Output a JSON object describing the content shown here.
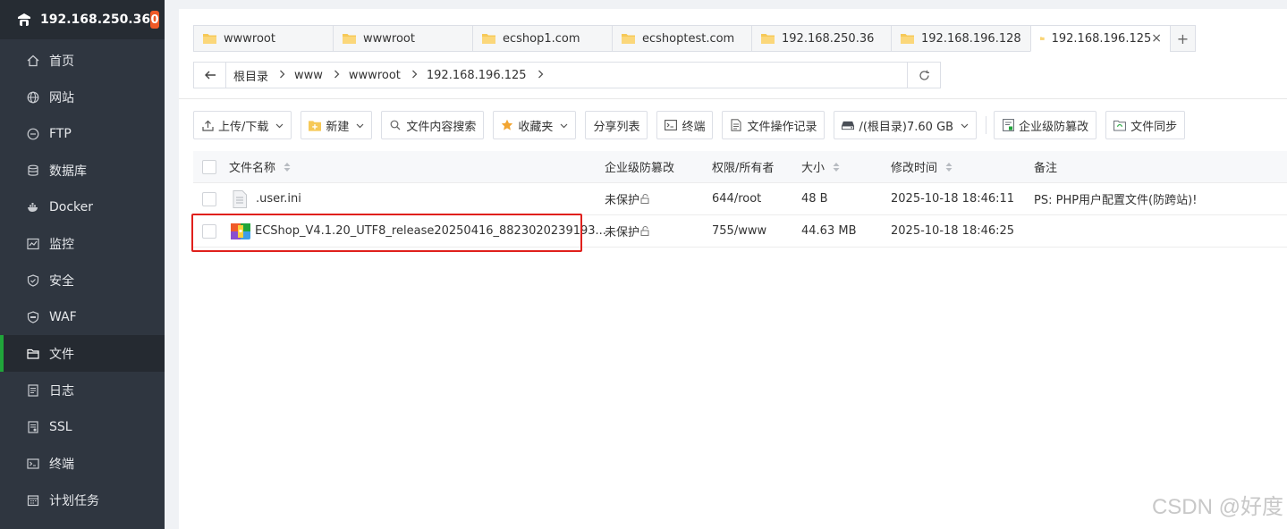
{
  "server": {
    "ip": "192.168.250.36",
    "badge": "0"
  },
  "sidebar": {
    "items": [
      {
        "label": "首页",
        "icon": "home-icon"
      },
      {
        "label": "网站",
        "icon": "globe-icon"
      },
      {
        "label": "FTP",
        "icon": "ftp-icon"
      },
      {
        "label": "数据库",
        "icon": "database-icon"
      },
      {
        "label": "Docker",
        "icon": "docker-icon"
      },
      {
        "label": "监控",
        "icon": "monitor-icon"
      },
      {
        "label": "安全",
        "icon": "shield-icon"
      },
      {
        "label": "WAF",
        "icon": "waf-icon"
      },
      {
        "label": "文件",
        "icon": "folder-icon",
        "active": true
      },
      {
        "label": "日志",
        "icon": "log-icon"
      },
      {
        "label": "SSL",
        "icon": "ssl-icon"
      },
      {
        "label": "终端",
        "icon": "terminal-icon"
      },
      {
        "label": "计划任务",
        "icon": "calendar-icon"
      }
    ]
  },
  "tabs": [
    {
      "label": "wwwroot"
    },
    {
      "label": "wwwroot"
    },
    {
      "label": "ecshop1.com"
    },
    {
      "label": "ecshoptest.com"
    },
    {
      "label": "192.168.250.36"
    },
    {
      "label": "192.168.196.128"
    },
    {
      "label": "192.168.196.125",
      "active": true,
      "close": "×"
    }
  ],
  "tab_add": "+",
  "breadcrumb": [
    "根目录",
    "www",
    "wwwroot",
    "192.168.196.125"
  ],
  "toolbar": {
    "upload": "上传/下载",
    "new": "新建",
    "search": "文件内容搜索",
    "favorites": "收藏夹",
    "share": "分享列表",
    "terminal": "终端",
    "oplog": "文件操作记录",
    "disk": "/(根目录)7.60 GB",
    "tamper": "企业级防篡改",
    "sync": "文件同步"
  },
  "table": {
    "headers": {
      "name": "文件名称",
      "tamper": "企业级防篡改",
      "perm": "权限/所有者",
      "size": "大小",
      "mtime": "修改时间",
      "note": "备注"
    },
    "rows": [
      {
        "name": ".user.ini",
        "type": "file",
        "tamper": "未保护",
        "perm": "644/root",
        "size": "48 B",
        "mtime": "2025-10-18 18:46:11",
        "note": "PS: PHP用户配置文件(防跨站)!"
      },
      {
        "name": "ECShop_V4.1.20_UTF8_release20250416_8823020239193...",
        "type": "archive",
        "tamper": "未保护",
        "perm": "755/www",
        "size": "44.63 MB",
        "mtime": "2025-10-18 18:46:25",
        "note": ""
      }
    ]
  },
  "watermark": "CSDN @好度",
  "colors": {
    "sidebar_bg": "#2f3640",
    "accent": "#20a53a",
    "badge": "#f05a28",
    "highlight": "#e0201c"
  }
}
